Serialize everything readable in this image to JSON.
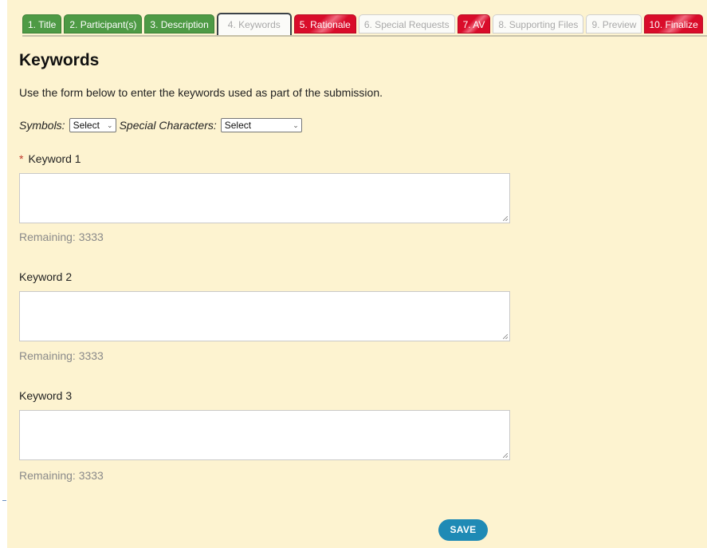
{
  "tabs": [
    {
      "label": "1. Title",
      "status": "complete"
    },
    {
      "label": "2. Participant(s)",
      "status": "complete"
    },
    {
      "label": "3. Description",
      "status": "complete"
    },
    {
      "label": "4. Keywords",
      "status": "active"
    },
    {
      "label": "5. Rationale",
      "status": "error"
    },
    {
      "label": "6. Special Requests",
      "status": "pending"
    },
    {
      "label": "7. AV",
      "status": "error"
    },
    {
      "label": "8. Supporting Files",
      "status": "pending"
    },
    {
      "label": "9. Preview",
      "status": "pending"
    },
    {
      "label": "10. Finalize",
      "status": "error"
    }
  ],
  "page": {
    "title": "Keywords",
    "intro": "Use the form below to enter the keywords used as part of the submission."
  },
  "symbols": {
    "symbols_label": "Symbols:",
    "symbols_value": "Select",
    "special_label": "Special Characters:",
    "special_value": "Select"
  },
  "keywords": [
    {
      "label": "Keyword 1",
      "required": true,
      "value": "",
      "remaining": "Remaining: 3333"
    },
    {
      "label": "Keyword 2",
      "required": false,
      "value": "",
      "remaining": "Remaining: 3333"
    },
    {
      "label": "Keyword 3",
      "required": false,
      "value": "",
      "remaining": "Remaining: 3333"
    }
  ],
  "required_marker": "*",
  "save_label": "SAVE",
  "colors": {
    "complete": "#4e9a45",
    "error": "#d90c2a",
    "pending": "#fbfbf8",
    "background": "#fdf3d0",
    "save": "#1f8ab5"
  }
}
